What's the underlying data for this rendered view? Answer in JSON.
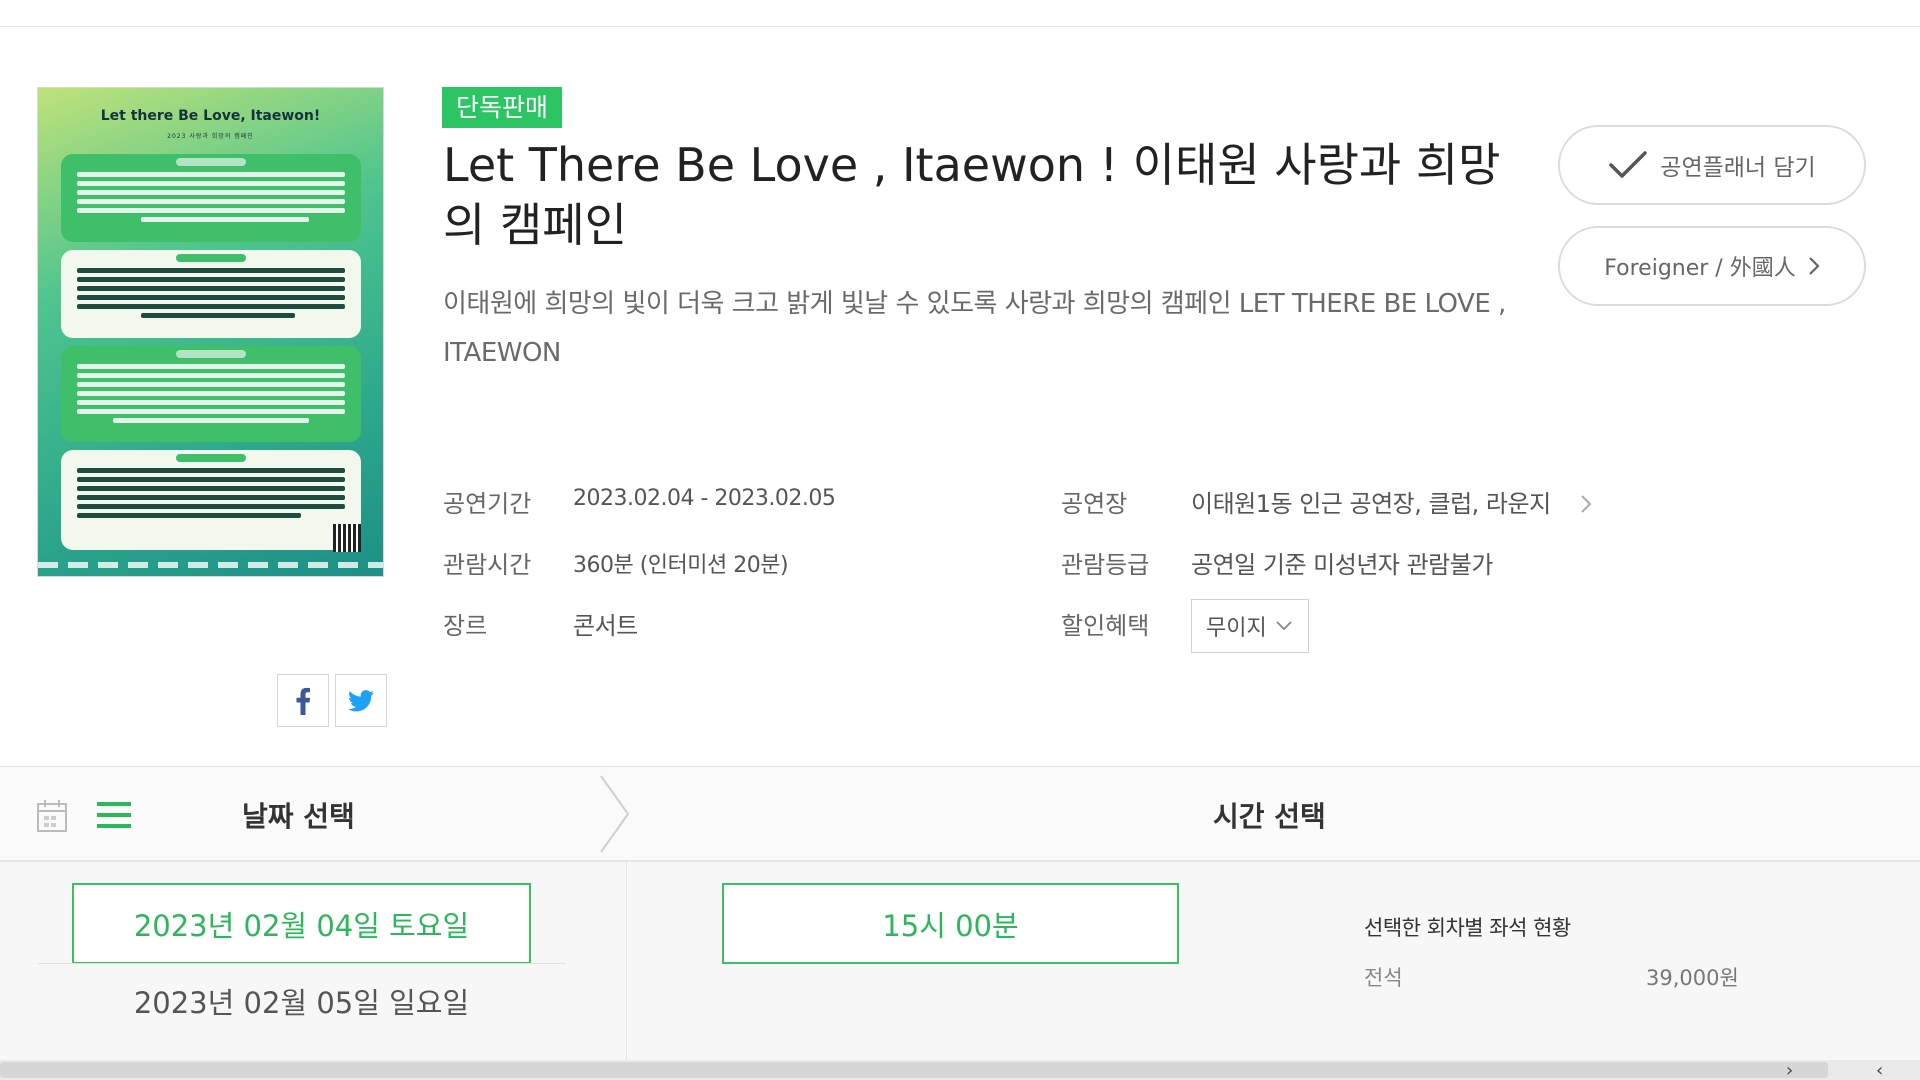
{
  "badge": "단독판매",
  "title": "Let There Be Love , Itaewon ! 이태원 사랑과 희망의 캠페인",
  "subtitle": "이태원에 희망의 빛이 더욱 크고 밝게 빛날 수 있도록 사랑과 희망의 캠페인 LET THERE BE LOVE , ITAEWON",
  "poster": {
    "heading": "Let there Be Love, Itaewon!",
    "tagline": "2023 사랑과 희망의 캠페인"
  },
  "buttons": {
    "planner": "공연플래너 담기",
    "foreigner": "Foreigner / 外國人"
  },
  "info": {
    "period_label": "공연기간",
    "period_value": "2023.02.04 - 2023.02.05",
    "runtime_label": "관람시간",
    "runtime_value": "360분 (인터미션 20분)",
    "genre_label": "장르",
    "genre_value": "콘서트",
    "venue_label": "공연장",
    "venue_value": "이태원1동 인근 공연장, 클럽, 라운지",
    "rating_label": "관람등급",
    "rating_value": "공연일 기준 미성년자 관람불가",
    "discount_label": "할인혜택",
    "discount_value": "무이지"
  },
  "tabs": {
    "date": "날짜 선택",
    "time": "시간 선택"
  },
  "dates": [
    "2023년 02월 04일 토요일",
    "2023년 02월 05일 일요일"
  ],
  "times": [
    "15시 00분"
  ],
  "seats": {
    "title": "선택한 회차별 좌석 현황",
    "label": "전석",
    "price": "39,000원"
  },
  "colors": {
    "accent": "#2dc564",
    "facebook": "#3b5998",
    "twitter": "#1da1f2"
  }
}
